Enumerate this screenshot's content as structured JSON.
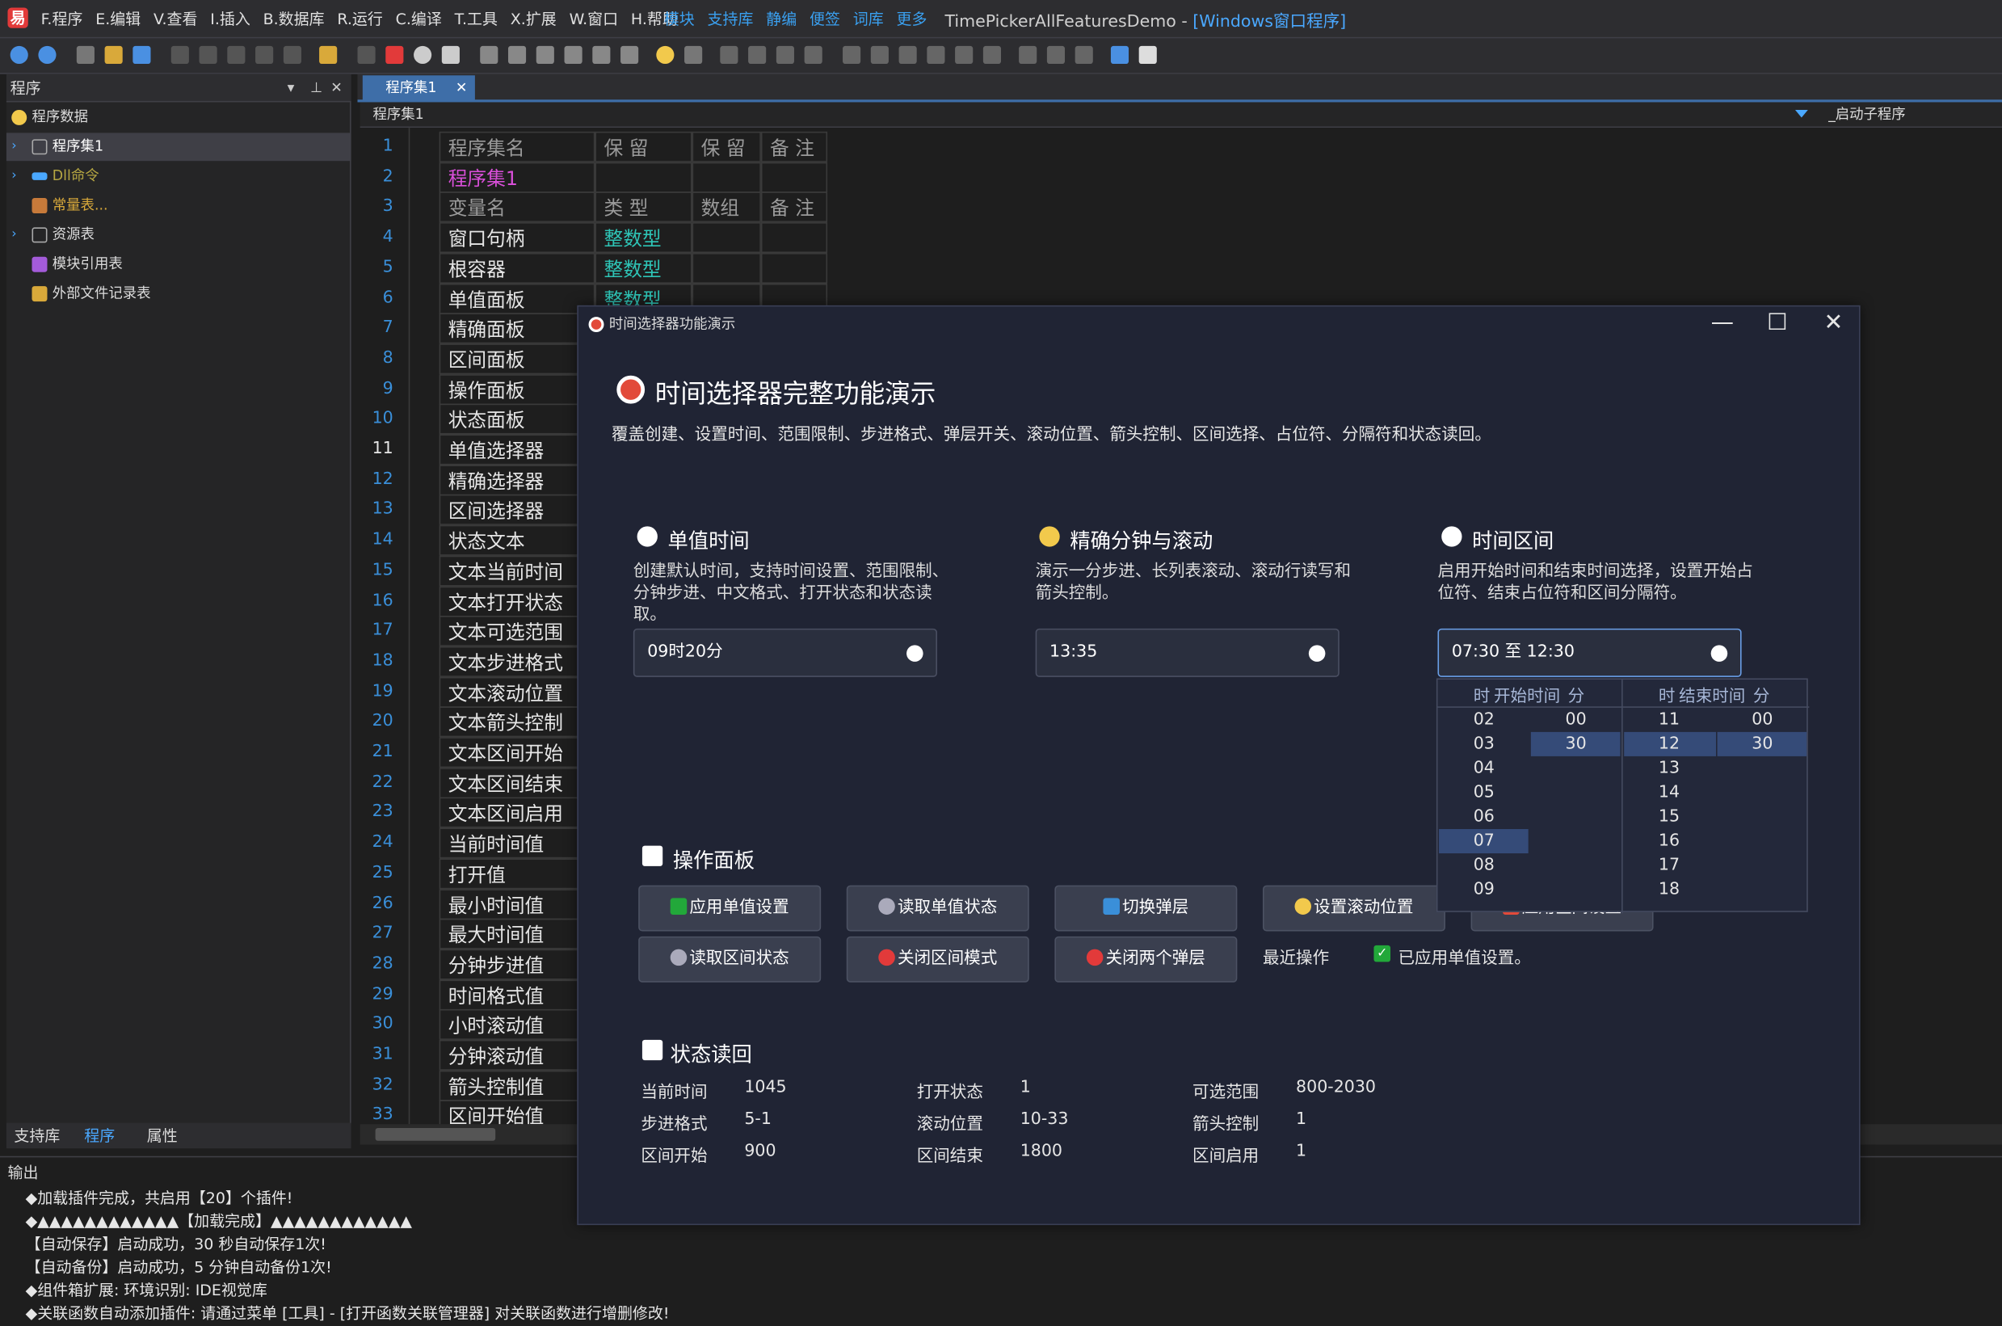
{
  "menubar": {
    "menus": [
      "F.程序",
      "E.编辑",
      "V.查看",
      "I.插入",
      "B.数据库",
      "R.运行",
      "C.编译",
      "T.工具",
      "X.扩展",
      "W.窗口",
      "H.帮助"
    ],
    "quicklinks": [
      "模块",
      "支持库",
      "静编",
      "便签",
      "词库",
      "更多"
    ],
    "title_main": "TimePickerAllFeaturesDemo - ",
    "title_hl": "[Windows窗口程序]"
  },
  "leftpanel": {
    "title": "程序",
    "items": [
      "程序数据",
      "程序集1",
      "Dll命令",
      "常量表...",
      "资源表",
      "模块引用表",
      "外部文件记录表"
    ],
    "tabs": [
      "支持库",
      "程序",
      "属性"
    ]
  },
  "doc": {
    "tab": "程序集1",
    "path": "程序集1",
    "right_path": "_启动子程序"
  },
  "editor": {
    "line_numbers": [
      "1",
      "2",
      "3",
      "4",
      "5",
      "6",
      "7",
      "8",
      "9",
      "10",
      "11",
      "12",
      "13",
      "14",
      "15",
      "16",
      "17",
      "18",
      "19",
      "20",
      "21",
      "22",
      "23",
      "24",
      "25",
      "26",
      "27",
      "28",
      "29",
      "30",
      "31",
      "32",
      "33"
    ],
    "header1": [
      "程序集名",
      "保 留",
      "保 留",
      "备 注"
    ],
    "assembly": "程序集1",
    "header2": [
      "变量名",
      "类 型",
      "数组",
      "备 注"
    ],
    "vars": [
      "窗口句柄",
      "根容器",
      "单值面板",
      "精确面板",
      "区间面板",
      "操作面板",
      "状态面板",
      "单值选择器",
      "精确选择器",
      "区间选择器",
      "状态文本",
      "文本当前时间",
      "文本打开状态",
      "文本可选范围",
      "文本步进格式",
      "文本滚动位置",
      "文本箭头控制",
      "文本区间开始",
      "文本区间结束",
      "文本区间启用",
      "当前时间值",
      "打开值",
      "最小时间值",
      "最大时间值",
      "分钟步进值",
      "时间格式值",
      "小时滚动值",
      "分钟滚动值",
      "箭头控制值",
      "区间开始值"
    ],
    "types": [
      "整数型",
      "整数型",
      "整数型"
    ]
  },
  "output": {
    "title": "输出",
    "lines": [
      "◆加载插件完成，共启用【20】个插件!",
      "◆▲▲▲▲▲▲▲▲▲▲▲▲【加载完成】▲▲▲▲▲▲▲▲▲▲▲▲",
      "【自动保存】启动成功，30 秒自动保存1次!",
      "【自动备份】启动成功，5 分钟自动备份1次!",
      "◆组件箱扩展:   环境识别:  IDE视觉库",
      "◆关联函数自动添加插件: 请通过菜单 [工具] - [打开函数关联管理器] 对关联函数进行增删修改!"
    ]
  },
  "dialog": {
    "window_title": "时间选择器功能演示",
    "heading": "时间选择器完整功能演示",
    "subtitle": "覆盖创建、设置时间、范围限制、步进格式、弹层开关、滚动位置、箭头控制、区间选择、占位符、分隔符和状态读回。",
    "sections": [
      {
        "title": "单值时间",
        "desc": "创建默认时间，支持时间设置、范围限制、分钟步进、中文格式、打开状态和状态读取。",
        "value": "09时20分"
      },
      {
        "title": "精确分钟与滚动",
        "desc": "演示一分步进、长列表滚动、滚动行读写和箭头控制。",
        "value": "13:35"
      },
      {
        "title": "时间区间",
        "desc": "启用开始时间和结束时间选择，设置开始占位符、结束占位符和区间分隔符。",
        "value": "07:30 至 12:30"
      }
    ],
    "popup": {
      "start_label_h": "时",
      "start_label": "开始时间",
      "start_label_m": "分",
      "end_label_h": "时",
      "end_label": "结束时间",
      "end_label_m": "分",
      "start_hours": [
        "02",
        "03",
        "04",
        "05",
        "06",
        "07",
        "08",
        "09"
      ],
      "start_minutes": [
        "00",
        "30"
      ],
      "end_hours": [
        "11",
        "12",
        "13",
        "14",
        "15",
        "16",
        "17",
        "18"
      ],
      "end_minutes": [
        "00",
        "30"
      ]
    },
    "ops": {
      "title": "操作面板",
      "buttons": [
        "应用单值设置",
        "读取单值状态",
        "切换弹层",
        "设置滚动位置",
        "应用区间设置",
        "读取区间状态",
        "关闭区间模式",
        "关闭两个弹层"
      ],
      "recent_label": "最近操作",
      "recent_value": "已应用单值设置。"
    },
    "status": {
      "title": "状态读回",
      "rows": [
        [
          {
            "k": "当前时间",
            "v": "1045"
          },
          {
            "k": "打开状态",
            "v": "1"
          },
          {
            "k": "可选范围",
            "v": "800-2030"
          }
        ],
        [
          {
            "k": "步进格式",
            "v": "5-1"
          },
          {
            "k": "滚动位置",
            "v": "10-33"
          },
          {
            "k": "箭头控制",
            "v": "1"
          }
        ],
        [
          {
            "k": "区间开始",
            "v": "900"
          },
          {
            "k": "区间结束",
            "v": "1800"
          },
          {
            "k": "区间启用",
            "v": "1"
          }
        ]
      ]
    }
  }
}
